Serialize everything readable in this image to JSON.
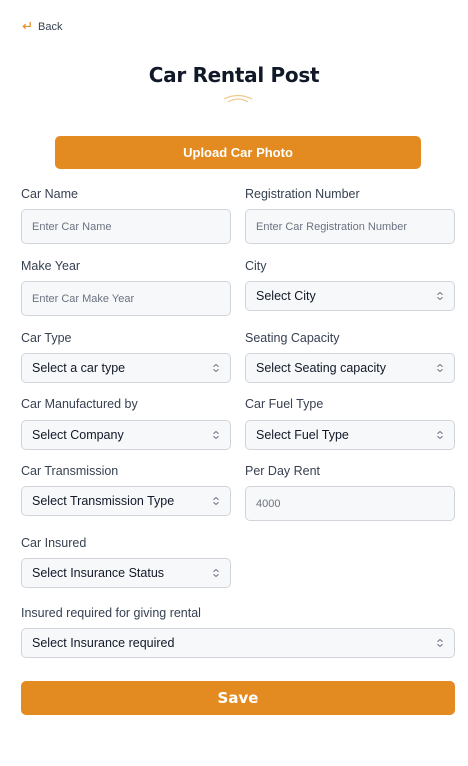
{
  "nav": {
    "back_label": "Back"
  },
  "page": {
    "title": "Car Rental Post"
  },
  "upload": {
    "label": "Upload Car Photo"
  },
  "colors": {
    "accent": "#e38b21",
    "field_bg": "#f7f8fa",
    "field_border": "#d1d5db",
    "title": "#111827"
  },
  "form": {
    "car_name": {
      "label": "Car Name",
      "placeholder": "Enter Car Name"
    },
    "registration": {
      "label": "Registration Number",
      "placeholder": "Enter Car Registration Number"
    },
    "make_year": {
      "label": "Make Year",
      "placeholder": "Enter Car Make Year"
    },
    "city": {
      "label": "City",
      "value": "Select City"
    },
    "car_type": {
      "label": "Car Type",
      "value": "Select a car type"
    },
    "seating": {
      "label": "Seating Capacity",
      "value": "Select Seating capacity"
    },
    "manufacturer": {
      "label": "Car Manufactured by",
      "value": "Select Company"
    },
    "fuel": {
      "label": "Car Fuel Type",
      "value": "Select Fuel Type"
    },
    "transmission": {
      "label": "Car Transmission",
      "value": "Select Transmission Type"
    },
    "per_day_rent": {
      "label": "Per Day Rent",
      "value": "4000"
    },
    "insured": {
      "label": "Car Insured",
      "value": "Select Insurance Status"
    },
    "insurance_required": {
      "label": "Insured required for giving rental",
      "value": "Select Insurance required"
    }
  },
  "actions": {
    "save_label": "Save"
  }
}
